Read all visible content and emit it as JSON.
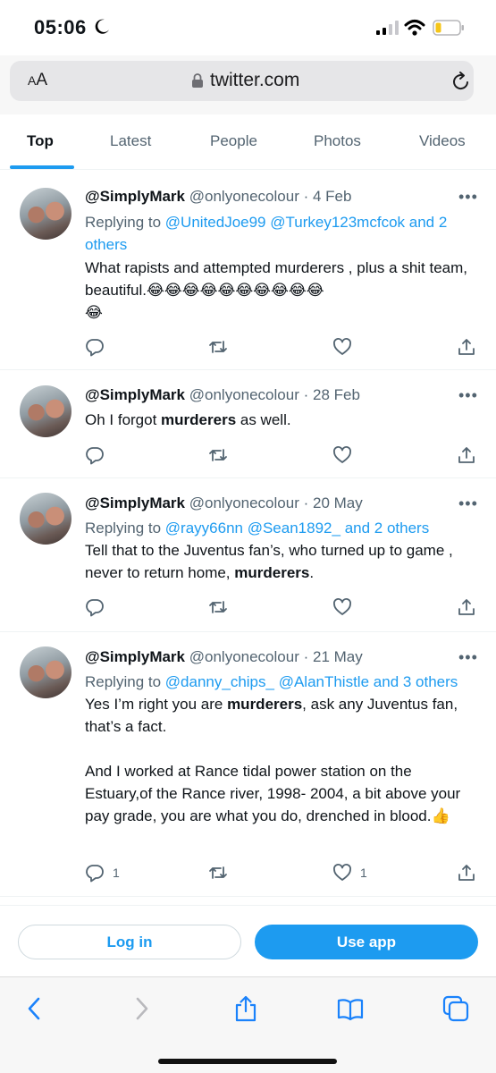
{
  "status": {
    "time": "05:06"
  },
  "url_bar": {
    "aa_small": "A",
    "aa_big": "A",
    "domain": "twitter.com"
  },
  "tabs": [
    {
      "label": "Top",
      "active": true
    },
    {
      "label": "Latest",
      "active": false
    },
    {
      "label": "People",
      "active": false
    },
    {
      "label": "Photos",
      "active": false
    },
    {
      "label": "Videos",
      "active": false
    }
  ],
  "tweets": [
    {
      "name": "@SimplyMark",
      "handle": "@onlyonecolour",
      "separator": "·",
      "date": "4 Feb",
      "replying_prefix": "Replying to",
      "replying_users": "@UnitedJoe99 @Turkey123mcfcok",
      "replying_more": "and 2 others",
      "text_lines": [
        "What rapists and attempted murderers , plus a shit team, beautiful.😂😂😂😂😂😂😂😂😂😂",
        "😂"
      ],
      "reply_count": "",
      "like_count": ""
    },
    {
      "name": "@SimplyMark",
      "handle": "@onlyonecolour",
      "separator": "·",
      "date": "28 Feb",
      "text_pre": "Oh I forgot ",
      "text_bold": "murderers",
      "text_post": " as well.",
      "reply_count": "",
      "like_count": ""
    },
    {
      "name": "@SimplyMark",
      "handle": "@onlyonecolour",
      "separator": "·",
      "date": "20 May",
      "replying_prefix": "Replying to",
      "replying_users": "@rayy66nn @Sean1892_",
      "replying_more": "and 2 others",
      "text_pre": "Tell that to the Juventus fan’s, who turned up to game , never to return home, ",
      "text_bold": "murderers",
      "text_post": ".",
      "reply_count": "",
      "like_count": ""
    },
    {
      "name": "@SimplyMark",
      "handle": "@onlyonecolour",
      "separator": "·",
      "date": "21 May",
      "replying_prefix": "Replying to",
      "replying_users": "@danny_chips_ @AlanThistle",
      "replying_more": "and 3 others",
      "text_pre": "Yes I’m right you are ",
      "text_bold": "murderers",
      "text_post": ", ask any Juventus fan, that’s a fact.",
      "text_para2": "And I worked at Rance tidal power station on the Estuary,of the Rance river, 1998- 2004, a bit above your pay grade, you are what you do, drenched in blood.👍",
      "reply_count": "1",
      "like_count": "1"
    }
  ],
  "cta": {
    "login": "Log in",
    "use_app": "Use app"
  },
  "icons": {
    "status": [
      "moon-icon",
      "signal-icon",
      "wifi-icon",
      "battery-icon"
    ],
    "url": [
      "lock-icon",
      "reload-icon"
    ],
    "actions": [
      "reply-icon",
      "retweet-icon",
      "like-icon",
      "share-icon"
    ],
    "safari": [
      "back-icon",
      "forward-icon",
      "share-icon",
      "bookmarks-icon",
      "tabs-icon"
    ]
  },
  "colors": {
    "accent": "#1d9bf0",
    "text": "#0f1419",
    "muted": "#536471"
  }
}
